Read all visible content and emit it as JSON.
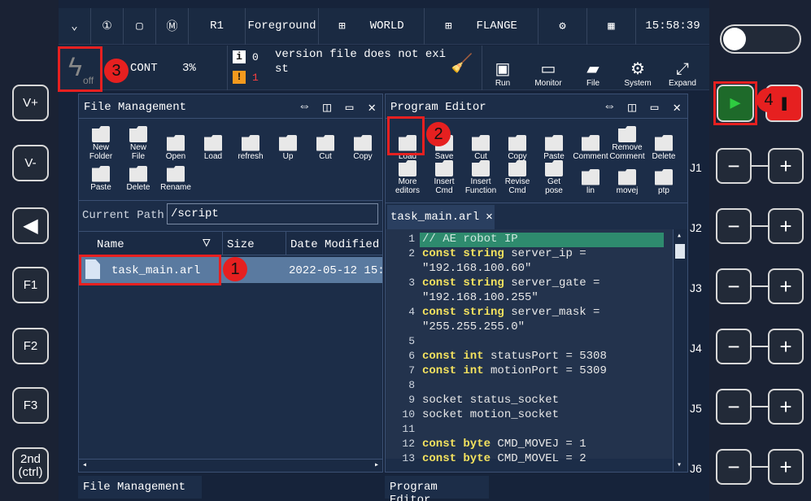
{
  "left_buttons": [
    "V+",
    "V-",
    "◀",
    "F1",
    "F2",
    "F3",
    "2nd\n(ctrl)"
  ],
  "topbar": {
    "r1": "R1",
    "foreground": "Foreground",
    "world": "WORLD",
    "flange": "FLANGE",
    "time": "15:58:39"
  },
  "status": {
    "power": "off",
    "cont": "CONT",
    "percent": "3%",
    "info_count": "0",
    "warn_count": "1",
    "message": "version file does not exi\nst"
  },
  "sys_buttons": [
    "Run",
    "Monitor",
    "File",
    "System",
    "Expand"
  ],
  "file_panel": {
    "title": "File Management",
    "tools_row1": [
      "New\nFolder",
      "New\nFile",
      "Open",
      "Load",
      "refresh",
      "Up",
      "Cut",
      "Copy"
    ],
    "tools_row2": [
      "Paste",
      "Delete",
      "Rename"
    ],
    "path_label": "Current Path",
    "path": "/script",
    "columns": [
      "Name",
      "Size",
      "Date Modified"
    ],
    "files": [
      {
        "name": "task_main.arl",
        "date": "2022-05-12 15:1"
      }
    ],
    "footer": "File Management"
  },
  "editor_panel": {
    "title": "Program Editor",
    "tools_row1": [
      "Load",
      "Save",
      "Cut",
      "Copy",
      "Paste",
      "Comment",
      "Remove\nComment",
      "Delete"
    ],
    "tools_row2": [
      "More\neditors",
      "Insert\nCmd",
      "Insert\nFunction",
      "Revise\nCmd",
      "Get\npose",
      "lin",
      "movej",
      "ptp"
    ],
    "tab": "task_main.arl",
    "lines": [
      {
        "n": "1",
        "html": "// AE robot IP"
      },
      {
        "n": "2",
        "html": "const string server_ip =\n\"192.168.100.60\""
      },
      {
        "n": "3",
        "html": "const string server_gate =\n\"192.168.100.255\""
      },
      {
        "n": "4",
        "html": "const string server_mask =\n\"255.255.255.0\""
      },
      {
        "n": "5",
        "html": ""
      },
      {
        "n": "6",
        "html": "const int statusPort = 5308"
      },
      {
        "n": "7",
        "html": "const int motionPort = 5309"
      },
      {
        "n": "8",
        "html": ""
      },
      {
        "n": "9",
        "html": "socket status_socket"
      },
      {
        "n": "10",
        "html": "socket motion_socket"
      },
      {
        "n": "11",
        "html": ""
      },
      {
        "n": "12",
        "html": "const byte CMD_MOVEJ = 1"
      },
      {
        "n": "13",
        "html": "const byte CMD_MOVEL = 2"
      }
    ],
    "footer": "Program Editor"
  },
  "joints": [
    "J1",
    "J2",
    "J3",
    "J4",
    "J5",
    "J6"
  ],
  "markers": [
    "1",
    "2",
    "3",
    "4"
  ],
  "colors": {
    "highlight": "#e62020",
    "accent": "#2ecc40",
    "selection": "#5a7aa0"
  }
}
